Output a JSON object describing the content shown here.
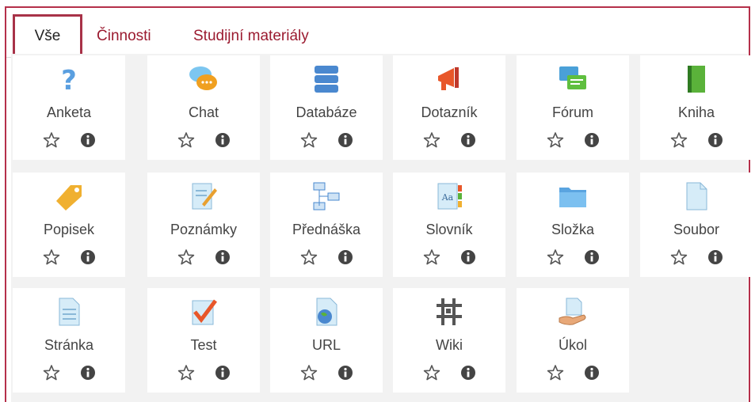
{
  "tabs": [
    {
      "label": "Vše",
      "active": true
    },
    {
      "label": "Činnosti",
      "active": false
    },
    {
      "label": "Studijní materiály",
      "active": false
    }
  ],
  "modules": [
    {
      "label": "Anketa",
      "icon": "question-icon"
    },
    {
      "label": "Chat",
      "icon": "chat-bubbles-icon"
    },
    {
      "label": "Databáze",
      "icon": "database-icon"
    },
    {
      "label": "Dotazník",
      "icon": "megaphone-icon"
    },
    {
      "label": "Fórum",
      "icon": "forum-icon"
    },
    {
      "label": "Kniha",
      "icon": "book-icon"
    },
    {
      "label": "Popisek",
      "icon": "tag-icon"
    },
    {
      "label": "Poznámky",
      "icon": "note-pencil-icon"
    },
    {
      "label": "Přednáška",
      "icon": "lesson-flow-icon"
    },
    {
      "label": "Slovník",
      "icon": "glossary-icon"
    },
    {
      "label": "Složka",
      "icon": "folder-icon"
    },
    {
      "label": "Soubor",
      "icon": "file-icon"
    },
    {
      "label": "Stránka",
      "icon": "page-icon"
    },
    {
      "label": "Test",
      "icon": "quiz-check-icon"
    },
    {
      "label": "URL",
      "icon": "url-globe-icon"
    },
    {
      "label": "Wiki",
      "icon": "wiki-icon"
    },
    {
      "label": "Úkol",
      "icon": "assignment-hand-icon"
    }
  ],
  "colors": {
    "accent": "#9b1b30",
    "frame": "#b5304a",
    "grid_bg": "#f2f2f2"
  }
}
